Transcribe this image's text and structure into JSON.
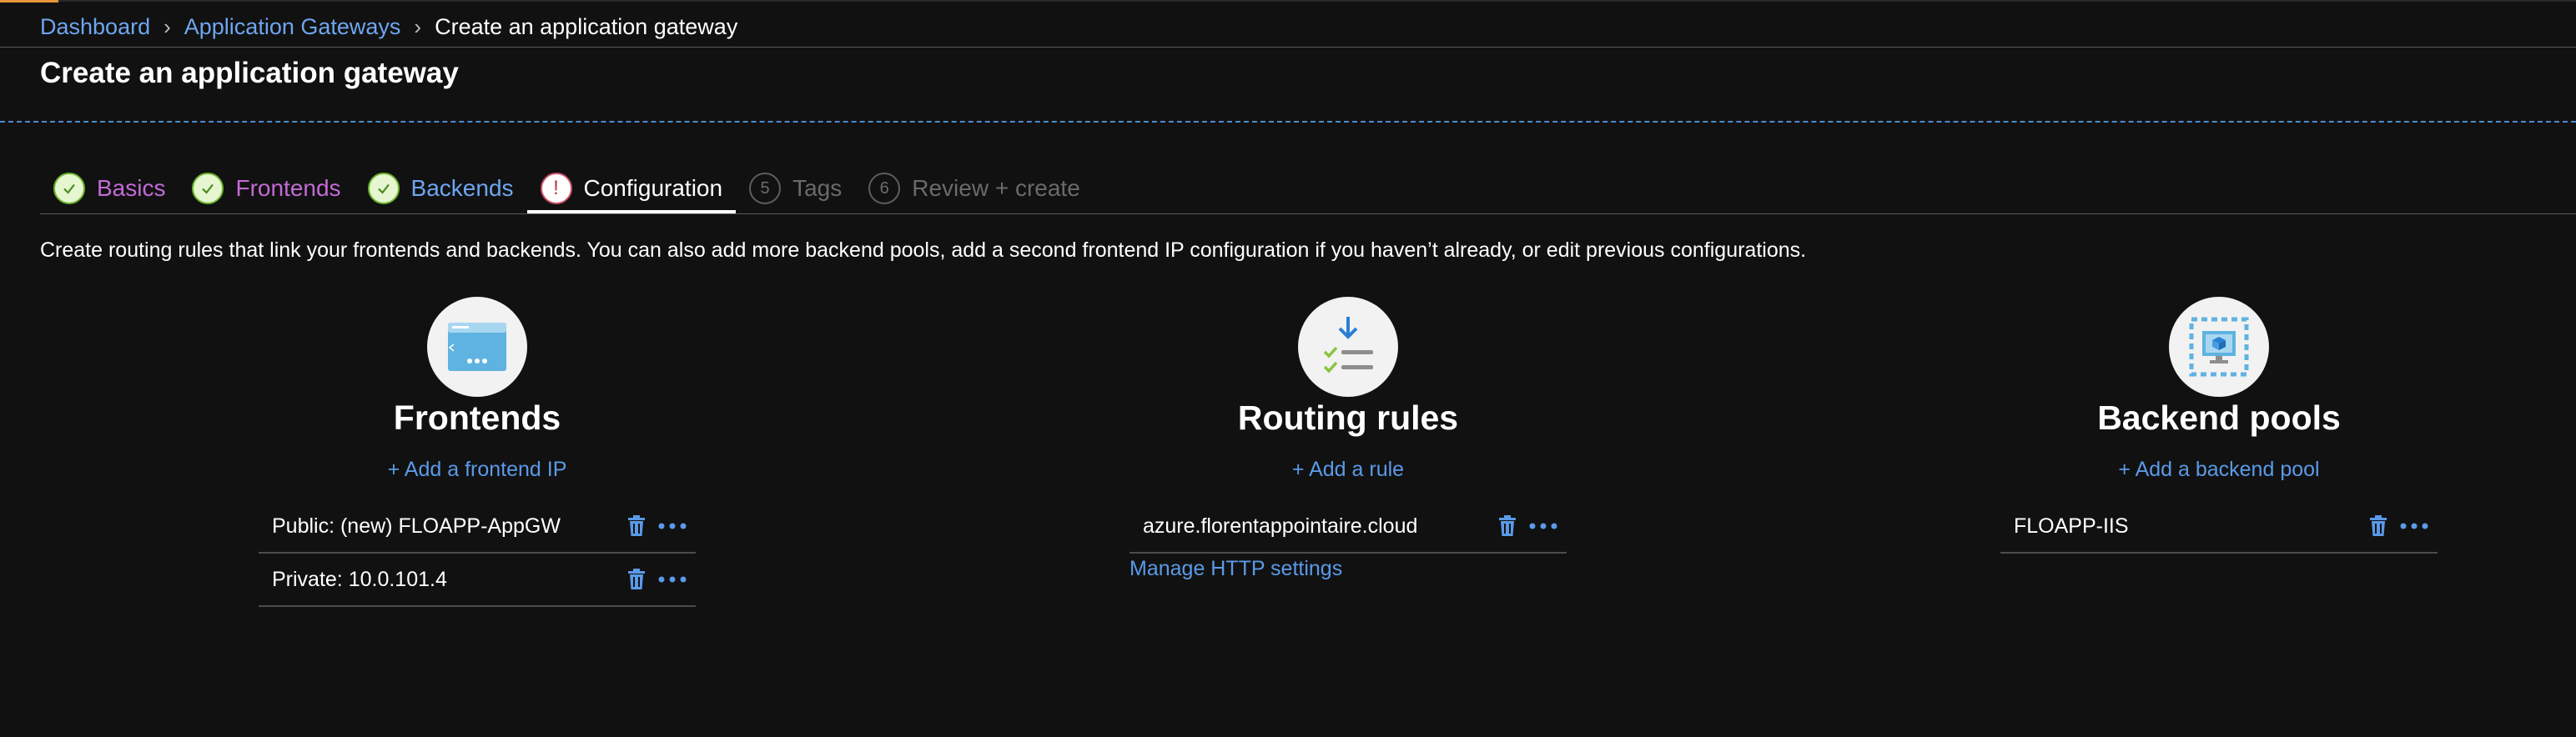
{
  "breadcrumb": {
    "items": [
      "Dashboard",
      "Application Gateways"
    ],
    "current": "Create an application gateway"
  },
  "page_title": "Create an application gateway",
  "tabs": [
    {
      "label": "Basics",
      "state": "completed"
    },
    {
      "label": "Frontends",
      "state": "completed"
    },
    {
      "label": "Backends",
      "state": "completed"
    },
    {
      "label": "Configuration",
      "state": "active-error",
      "marker": "!"
    },
    {
      "label": "Tags",
      "state": "pending",
      "number": "5"
    },
    {
      "label": "Review + create",
      "state": "pending",
      "number": "6"
    }
  ],
  "description": "Create routing rules that link your frontends and backends. You can also add more backend pools, add a second frontend IP configuration if you haven’t already, or edit previous configurations.",
  "frontends": {
    "title": "Frontends",
    "add_label": "+ Add a frontend IP",
    "items": [
      "Public: (new) FLOAPP-AppGW",
      "Private: 10.0.101.4"
    ]
  },
  "routing_rules": {
    "title": "Routing rules",
    "add_label": "+ Add a rule",
    "items": [
      "azure.florentappointaire.cloud"
    ],
    "manage_label": "Manage HTTP settings"
  },
  "backend_pools": {
    "title": "Backend pools",
    "add_label": "+ Add a backend pool",
    "items": [
      "FLOAPP-IIS"
    ]
  },
  "colors": {
    "background": "#111111",
    "link": "#6ea6f0",
    "completed_purple": "#c36ad6",
    "completed_check": "#6bb32e",
    "error": "#d0506a",
    "action_blue": "#5a9ae8"
  },
  "icons": {
    "completed": "check-icon",
    "error": "exclamation-icon",
    "delete": "trash-icon",
    "more": "more-options-icon"
  }
}
